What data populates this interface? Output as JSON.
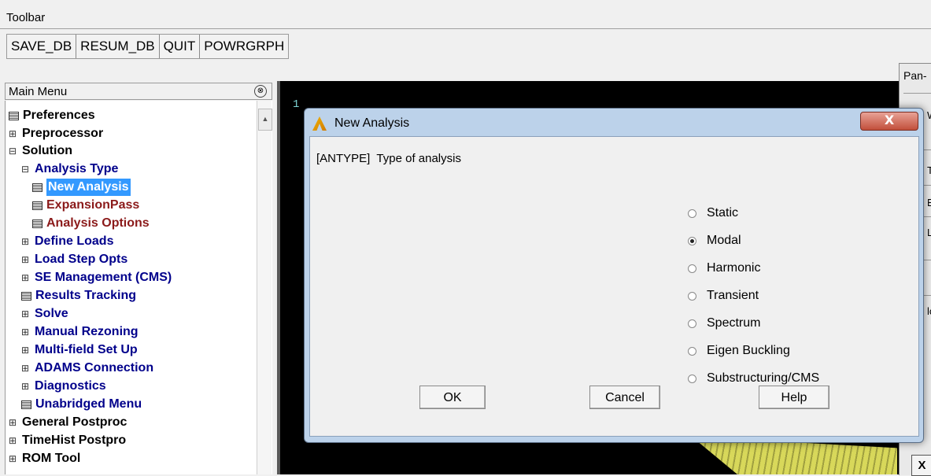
{
  "toolbar": {
    "label": "Toolbar",
    "buttons": [
      "SAVE_DB",
      "RESUM_DB",
      "QUIT",
      "POWRGRPH"
    ]
  },
  "main_menu": {
    "title": "Main Menu",
    "collapse_glyph": "⊗",
    "items": [
      "Preferences",
      "Preprocessor",
      "Solution",
      "Analysis Type",
      "New Analysis",
      "ExpansionPass",
      "Analysis Options",
      "Define Loads",
      "Load Step Opts",
      "SE Management (CMS)",
      "Results Tracking",
      "Solve",
      "Manual Rezoning",
      "Multi-field Set Up",
      "ADAMS Connection",
      "Diagnostics",
      "Unabridged Menu",
      "General Postproc",
      "TimeHist Postpro",
      "ROM Tool"
    ]
  },
  "graphics": {
    "window_number": "1"
  },
  "pan_panel": {
    "title": "Pan-",
    "rows": [
      "W",
      "T",
      "E",
      "L",
      "",
      "lc"
    ],
    "button": "X"
  },
  "dialog": {
    "title": "New Analysis",
    "close": "X",
    "field_label": "[ANTYPE]  Type of analysis",
    "options": [
      "Static",
      "Modal",
      "Harmonic",
      "Transient",
      "Spectrum",
      "Eigen Buckling",
      "Substructuring/CMS"
    ],
    "selected": "Modal",
    "buttons": {
      "ok": "OK",
      "cancel": "Cancel",
      "help": "Help"
    }
  },
  "colors": {
    "menu_blue": "#00008b",
    "menu_red": "#8b1a1a",
    "selection": "#3399ff",
    "dialog_frame": "#bcd2ea"
  }
}
